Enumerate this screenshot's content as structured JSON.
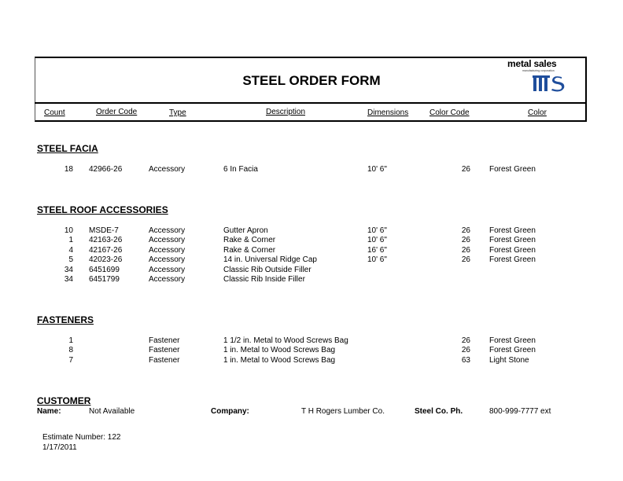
{
  "header": {
    "title": "STEEL ORDER FORM",
    "logo": {
      "name": "metal sales",
      "tagline": "manufacturing corporation",
      "mark": "ms",
      "brand_color": "#1f4e9c"
    },
    "columns": [
      "Count",
      "Order Code",
      "Type",
      "Description",
      "Dimensions",
      "Color Code",
      "Color"
    ]
  },
  "sections": [
    {
      "title": "STEEL FACIA",
      "rows": [
        {
          "count": "18",
          "order_code": "42966-26",
          "type": "Accessory",
          "description": "6 In Facia",
          "dimensions": "10' 6\"",
          "color_code": "26",
          "color": "Forest Green"
        }
      ]
    },
    {
      "title": "STEEL ROOF ACCESSORIES",
      "rows": [
        {
          "count": "10",
          "order_code": "MSDE-7",
          "type": "Accessory",
          "description": "Gutter Apron",
          "dimensions": "10' 6\"",
          "color_code": "26",
          "color": "Forest Green"
        },
        {
          "count": "1",
          "order_code": "42163-26",
          "type": "Accessory",
          "description": "Rake & Corner",
          "dimensions": "10' 6\"",
          "color_code": "26",
          "color": "Forest Green"
        },
        {
          "count": "4",
          "order_code": "42167-26",
          "type": "Accessory",
          "description": "Rake & Corner",
          "dimensions": "16' 6\"",
          "color_code": "26",
          "color": "Forest Green"
        },
        {
          "count": "5",
          "order_code": "42023-26",
          "type": "Accessory",
          "description": "14 in. Universal Ridge Cap",
          "dimensions": "10' 6\"",
          "color_code": "26",
          "color": "Forest Green"
        },
        {
          "count": "34",
          "order_code": "6451699",
          "type": "Accessory",
          "description": "Classic Rib Outside Filler",
          "dimensions": "",
          "color_code": "",
          "color": ""
        },
        {
          "count": "34",
          "order_code": "6451799",
          "type": "Accessory",
          "description": "Classic Rib Inside Filler",
          "dimensions": "",
          "color_code": "",
          "color": ""
        }
      ]
    },
    {
      "title": "FASTENERS",
      "rows": [
        {
          "count": "1",
          "order_code": "",
          "type": "Fastener",
          "description": "1 1/2 in. Metal to Wood Screws Bag",
          "dimensions": "",
          "color_code": "26",
          "color": "Forest Green"
        },
        {
          "count": "8",
          "order_code": "",
          "type": "Fastener",
          "description": "1 in. Metal to Wood Screws Bag",
          "dimensions": "",
          "color_code": "26",
          "color": "Forest Green"
        },
        {
          "count": "7",
          "order_code": "",
          "type": "Fastener",
          "description": "1 in. Metal to Wood Screws Bag",
          "dimensions": "",
          "color_code": "63",
          "color": "Light Stone"
        }
      ]
    }
  ],
  "customer": {
    "title": "CUSTOMER",
    "name_label": "Name:",
    "name_value": "Not Available",
    "company_label": "Company:",
    "company_value": "T H Rogers Lumber Co.",
    "phone_label": "Steel Co. Ph.",
    "phone_value": "800-999-7777 ext"
  },
  "footer": {
    "estimate": "Estimate Number: 122",
    "date": "1/17/2011"
  }
}
